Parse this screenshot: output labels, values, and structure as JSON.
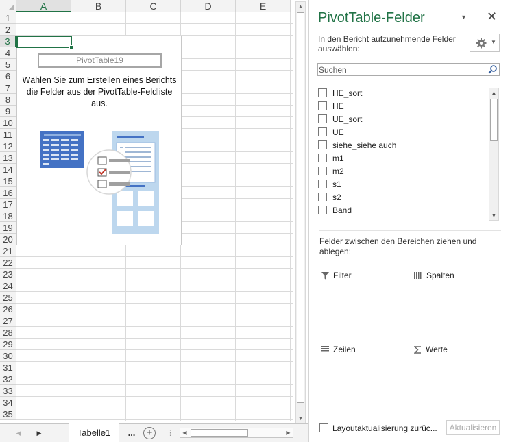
{
  "sheet": {
    "columns": [
      "A",
      "B",
      "C",
      "D",
      "E"
    ],
    "rows": [
      "1",
      "2",
      "3",
      "4",
      "5",
      "6",
      "7",
      "8",
      "9",
      "10",
      "11",
      "12",
      "13",
      "14",
      "15",
      "16",
      "17",
      "18",
      "19",
      "20",
      "21",
      "22",
      "23",
      "24",
      "25",
      "26",
      "27",
      "28",
      "29",
      "30",
      "31",
      "32",
      "33",
      "34",
      "35"
    ],
    "selected_column": "A",
    "selected_row": "3",
    "pivot_placeholder": {
      "name": "PivotTable19",
      "message": "Wählen Sie zum Erstellen eines Berichts die Felder aus der PivotTable-Feldliste aus."
    },
    "tabs": {
      "sheet_name": "Tabelle1",
      "more": "...",
      "add": "+",
      "prev_arrow": "◀",
      "next_arrow": "▶",
      "split": "⋮"
    },
    "scroll_arrows": {
      "up": "▲",
      "down": "▼",
      "left": "◀",
      "right": "▶"
    }
  },
  "pane": {
    "title": "PivotTable-Felder",
    "dropdown_glyph": "▼",
    "close_glyph": "✕",
    "subtitle": "In den Bericht aufzunehmende Felder auswählen:",
    "search_placeholder": "Suchen",
    "fields": [
      {
        "label": "HE_sort"
      },
      {
        "label": "HE"
      },
      {
        "label": "UE_sort"
      },
      {
        "label": "UE"
      },
      {
        "label": "siehe_siehe auch"
      },
      {
        "label": "m1"
      },
      {
        "label": "m2"
      },
      {
        "label": "s1"
      },
      {
        "label": "s2"
      },
      {
        "label": "Band"
      }
    ],
    "areas_label": "Felder zwischen den Bereichen ziehen und ablegen:",
    "areas": {
      "filter": "Filter",
      "columns": "Spalten",
      "rows": "Zeilen",
      "values": "Werte"
    },
    "defer_label": "Layoutaktualisierung zurüc...",
    "update_button": "Aktualisieren"
  },
  "colors": {
    "accent": "#217346",
    "illustration_blue": "#4472c4",
    "illustration_light": "#bdd7ee",
    "check_red": "#c0392b"
  }
}
